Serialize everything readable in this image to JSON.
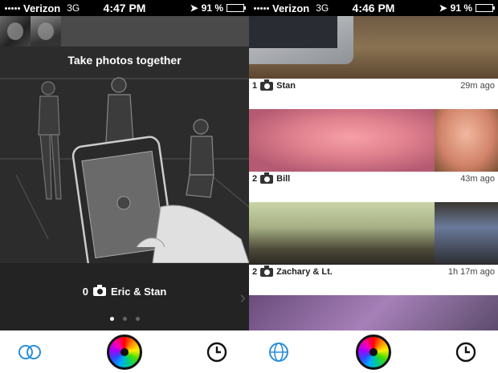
{
  "left_screen": {
    "status": {
      "carrier": "Verizon",
      "network": "3G",
      "time": "4:47 PM",
      "battery": "91 %",
      "battery_level": 0.91
    },
    "intro_title": "Take photos together",
    "caption": {
      "count": "0",
      "names": "Eric & Stan"
    },
    "pager": {
      "pages": 3,
      "active_index": 0
    },
    "tabs": [
      "people-icon",
      "camera-color-wheel",
      "clock-icon"
    ]
  },
  "right_screen": {
    "status": {
      "carrier": "Verizon",
      "network": "3G",
      "time": "4:46 PM",
      "battery": "91 %",
      "battery_level": 0.91
    },
    "feed": [
      {
        "count": "1",
        "name": "Stan",
        "ago": "29m ago"
      },
      {
        "count": "2",
        "name": "Bill",
        "ago": "43m ago"
      },
      {
        "count": "2",
        "name": "Zachary & Lt.",
        "ago": "1h 17m ago"
      }
    ],
    "tabs": [
      "globe-icon",
      "camera-color-wheel",
      "clock-icon"
    ]
  },
  "colors": {
    "accent_blue": "#2a8fd8",
    "tabbar_bg": "#ffffff",
    "status_bg": "#000000"
  }
}
